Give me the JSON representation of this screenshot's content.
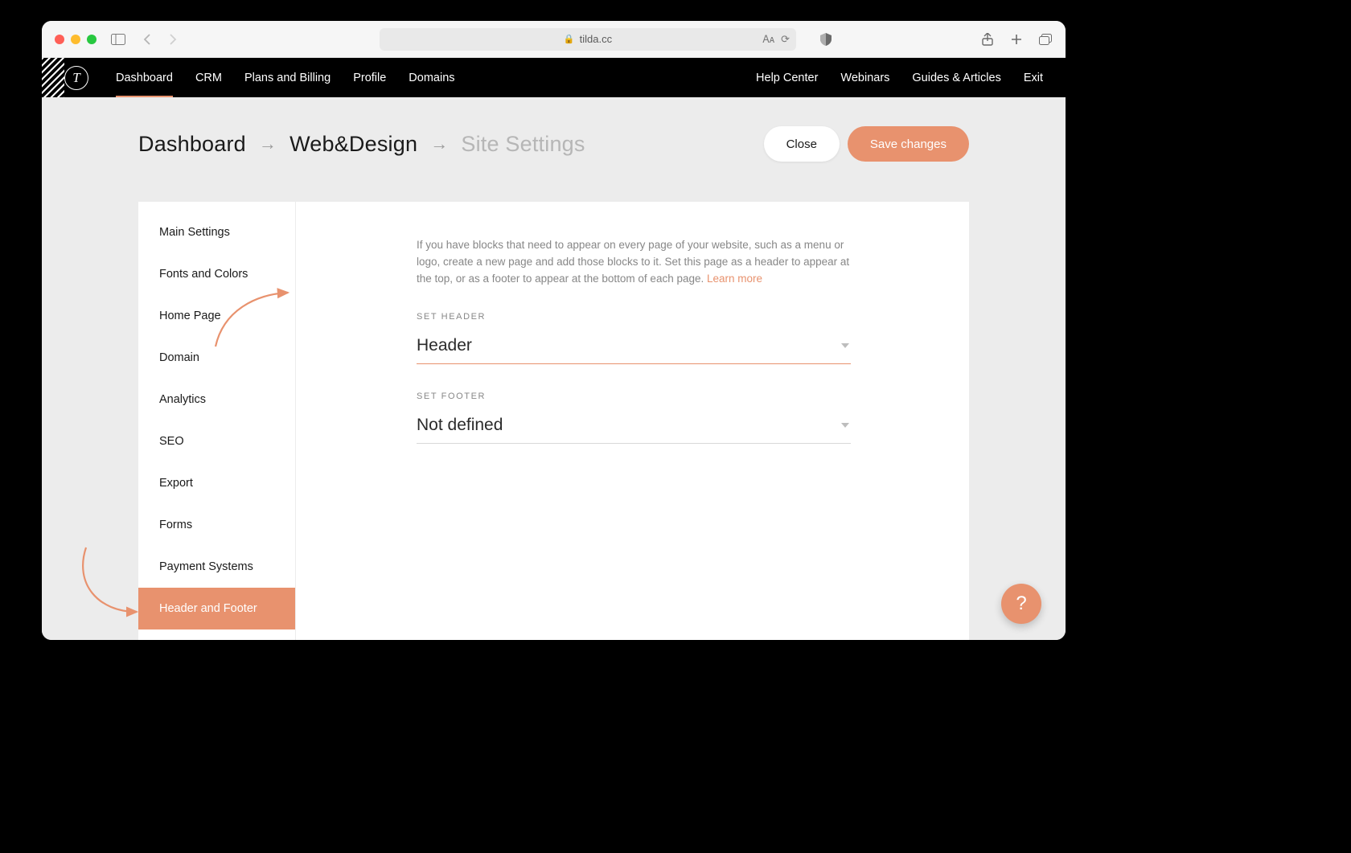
{
  "browser": {
    "url_host": "tilda.cc"
  },
  "nav": {
    "items": [
      "Dashboard",
      "CRM",
      "Plans and Billing",
      "Profile",
      "Domains"
    ],
    "right_items": [
      "Help Center",
      "Webinars",
      "Guides & Articles",
      "Exit"
    ],
    "active_index": 0
  },
  "breadcrumb": {
    "items": [
      "Dashboard",
      "Web&Design",
      "Site Settings"
    ]
  },
  "actions": {
    "close": "Close",
    "save": "Save changes"
  },
  "sidebar": {
    "items": [
      "Main Settings",
      "Fonts and Colors",
      "Home Page",
      "Domain",
      "Analytics",
      "SEO",
      "Export",
      "Forms",
      "Payment Systems",
      "Header and Footer"
    ],
    "active_index": 9
  },
  "content": {
    "description": "If you have blocks that need to appear on every page of your website, such as a menu or logo, create a new page and add those blocks to it. Set this page as a header to appear at the top, or as a footer to appear at the bottom of each page. ",
    "learn_more": "Learn more",
    "set_header_label": "SET HEADER",
    "header_value": "Header",
    "set_footer_label": "SET FOOTER",
    "footer_value": "Not defined"
  },
  "help_fab": "?"
}
